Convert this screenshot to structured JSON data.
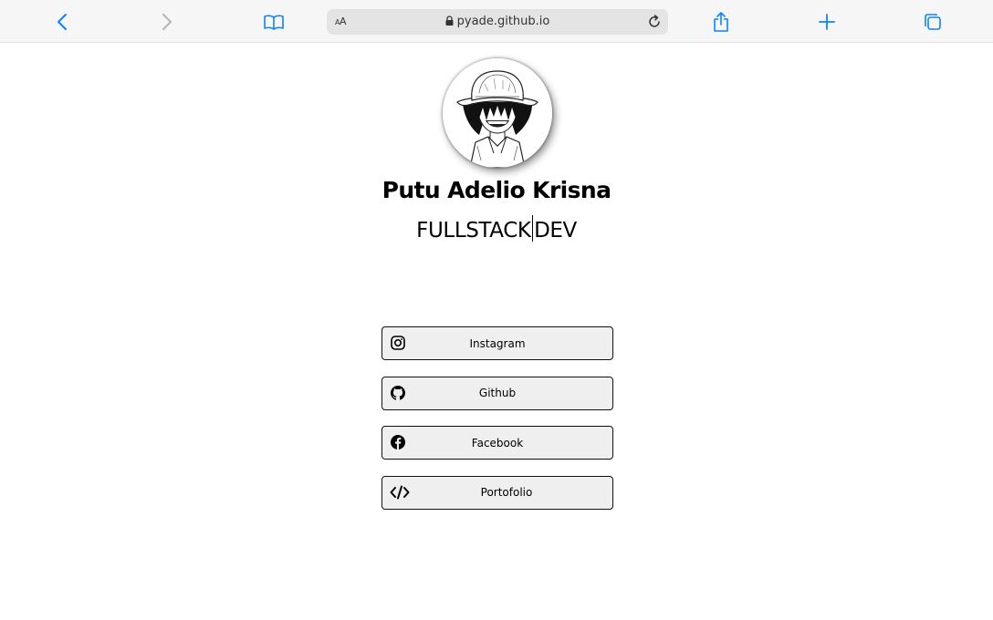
{
  "browser": {
    "text_size_label": "AA",
    "url": "pyade.github.io",
    "accent_color": "#0a84ff",
    "icons": [
      "back-icon",
      "forward-icon",
      "reader-icon",
      "lock-icon",
      "reload-icon",
      "share-icon",
      "new-tab-icon",
      "tabs-icon"
    ]
  },
  "profile": {
    "name": "Putu Adelio Krisna",
    "role_left": "FULLSTACK",
    "role_right": "DEV"
  },
  "links": [
    {
      "label": "Instagram",
      "icon": "instagram-icon"
    },
    {
      "label": "Github",
      "icon": "github-icon"
    },
    {
      "label": "Facebook",
      "icon": "facebook-icon"
    },
    {
      "label": "Portofolio",
      "icon": "code-icon"
    }
  ]
}
